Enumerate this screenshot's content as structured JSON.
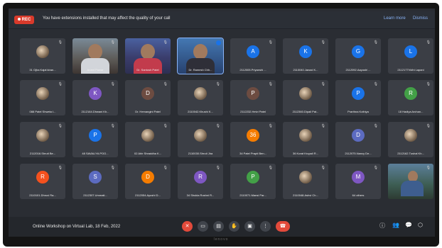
{
  "banner": {
    "rec_label": "REC",
    "message": "You have extensions installed that may affect the quality of your call",
    "learn_more": "Learn more",
    "dismiss": "Dismiss"
  },
  "participants": [
    {
      "name": "31 Ojha Kajal kiran...",
      "avatar": "",
      "color": "#c0392b"
    },
    {
      "name": "Anant Pawar",
      "avatar": "",
      "color": "#5a5a5a"
    },
    {
      "name": "Dr. Santosh Patel",
      "avatar": "",
      "color": "#5a5a5a"
    },
    {
      "name": "Dr. Ramesh Chh...",
      "avatar": "",
      "color": "#5a5a5a"
    },
    {
      "name": "2112005.Priyanshi ...",
      "avatar": "A",
      "color": "#1a73e8"
    },
    {
      "name": "2110040.Janaxi K...",
      "avatar": "K",
      "color": "#1a73e8"
    },
    {
      "name": "2112092.Aayushi ...",
      "avatar": "G",
      "color": "#1a73e8"
    },
    {
      "name": "2112177Vidhi Lapani",
      "avatar": "L",
      "color": "#1a73e8"
    },
    {
      "name": "088 Patel Shweta I...",
      "avatar": "",
      "color": "#5a5a5a"
    },
    {
      "name": "2112164.Dhwani Kh...",
      "avatar": "K",
      "color": "#7e57c2"
    },
    {
      "name": "Dr. Hemangini Patel",
      "avatar": "D",
      "color": "#6d4c41"
    },
    {
      "name": "2110042.Khushi K...",
      "avatar": "",
      "color": "#8d6e63"
    },
    {
      "name": "2112232.Hetvi Patel",
      "avatar": "P",
      "color": "#6d4c41"
    },
    {
      "name": "2112360.Dipali Pat...",
      "avatar": "",
      "color": "#bdbdbd"
    },
    {
      "name": "Prarthna Kothiya",
      "avatar": "P",
      "color": "#1a73e8"
    },
    {
      "name": "18 Hadiya Archan...",
      "avatar": "R",
      "color": "#43a047"
    },
    {
      "name": "2112016.Shruti Be...",
      "avatar": "",
      "color": "#c9a46a"
    },
    {
      "name": "48 SAVALIYA POO...",
      "avatar": "P",
      "color": "#1a73e8"
    },
    {
      "name": "02 Ahir Shraddha K...",
      "avatar": "",
      "color": "#a1887f"
    },
    {
      "name": "2110030.Shruti Jha",
      "avatar": "",
      "color": "#8d6e63"
    },
    {
      "name": "34 Patel Prapti Ben...",
      "avatar": "36",
      "color": "#f57c00"
    },
    {
      "name": "36 Korat Krupali R...",
      "avatar": "",
      "color": "#8d6e63"
    },
    {
      "name": "2112075.Nancy De...",
      "avatar": "D",
      "color": "#5c6bc0"
    },
    {
      "name": "2112162.Tushal Kh...",
      "avatar": "",
      "color": "#90a4ae"
    },
    {
      "name": "2110101.Dhruvi Ra...",
      "avatar": "R",
      "color": "#f4511e"
    },
    {
      "name": "2112307.Ummati...",
      "avatar": "S",
      "color": "#5c6bc0"
    },
    {
      "name": "2112054.Ayushi D...",
      "avatar": "D",
      "color": "#f57c00"
    },
    {
      "name": "34 Shukla Roshni R...",
      "avatar": "R",
      "color": "#7e57c2"
    },
    {
      "name": "2110071.Mansi Par...",
      "avatar": "P",
      "color": "#43a047"
    },
    {
      "name": "2110048.Ashvi Ch...",
      "avatar": "",
      "color": "#90a4ae"
    },
    {
      "name": "64 others",
      "avatar": "M",
      "color": "#7e57c2"
    },
    {
      "name": "",
      "avatar": "",
      "color": "#5a5a5a"
    }
  ],
  "footer": {
    "meeting_title": "Online Workshop on Virtual Lab, 18 Feb, 2022"
  },
  "icons": {
    "mic_off": "mic-off-icon",
    "camera": "camera-icon",
    "captions": "captions-icon",
    "raise_hand": "raise-hand-icon",
    "present": "present-screen-icon",
    "more": "more-options-icon",
    "end_call": "end-call-icon",
    "info": "info-icon",
    "people": "people-icon",
    "chat": "chat-icon",
    "activities": "activities-icon"
  },
  "brand": "lenovo"
}
